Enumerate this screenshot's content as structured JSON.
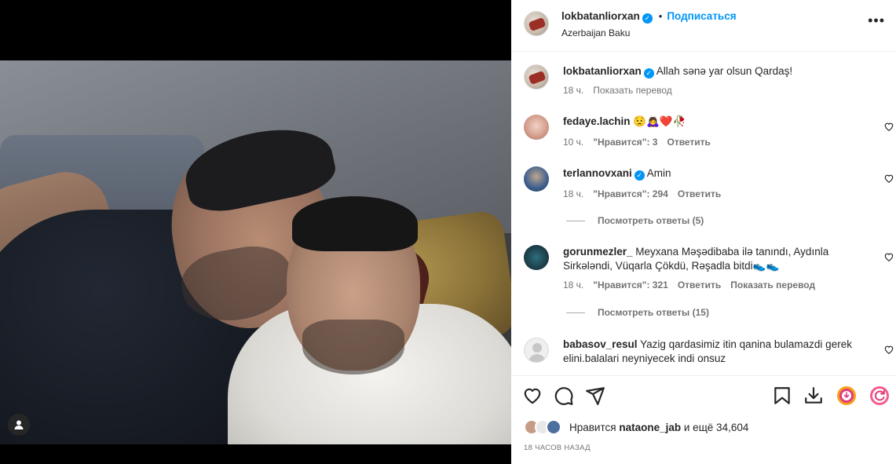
{
  "post": {
    "author": "lokbatanliorxan",
    "follow_label": "Подписаться",
    "dot": "•",
    "location": "Azerbaijan Baku",
    "more_label": "•••"
  },
  "caption": {
    "author": "lokbatanliorxan",
    "text": "Allah sənə yar olsun Qardaş!",
    "time": "18 ч.",
    "translate": "Показать перевод"
  },
  "comments": [
    {
      "author": "fedaye.lachin",
      "text": "😟🙇‍♀️❤️🥀",
      "time": "10 ч.",
      "likes": "\"Нравится\": 3",
      "reply": "Ответить"
    },
    {
      "author": "terlannovxani",
      "verified": true,
      "text": "Amin",
      "time": "18 ч.",
      "likes": "\"Нравится\": 294",
      "reply": "Ответить",
      "view_replies": "Посмотреть ответы (5)"
    },
    {
      "author": "gorunmezler_",
      "text": "Meyxana Məşədibaba ilə tanındı, Aydınla Sirkələndi, Vüqarla Çökdü, Rəşadla bitdi👟👟",
      "time": "18 ч.",
      "likes": "\"Нравится\": 321",
      "reply": "Ответить",
      "translate": "Показать перевод",
      "view_replies": "Посмотреть ответы (15)"
    },
    {
      "author": "babasov_resul",
      "text": "Yazig qardasimiz itin qanina bulamazdi gerek elini.balalari neyniyecek indi onsuz"
    }
  ],
  "likes": {
    "prefix": "Нравится",
    "user": "nataone_jab",
    "suffix": "и ещё 34,604"
  },
  "time_ago": "18 ЧАСОВ НАЗАД",
  "icons": {
    "like": "heart-icon",
    "comment": "comment-icon",
    "share": "paper-plane-icon",
    "save": "bookmark-icon",
    "download": "download-icon",
    "ext1": "extension-icon",
    "ext2": "extension-icon"
  },
  "colors": {
    "accent": "#0095f6",
    "text": "#262626",
    "muted": "#737373"
  }
}
